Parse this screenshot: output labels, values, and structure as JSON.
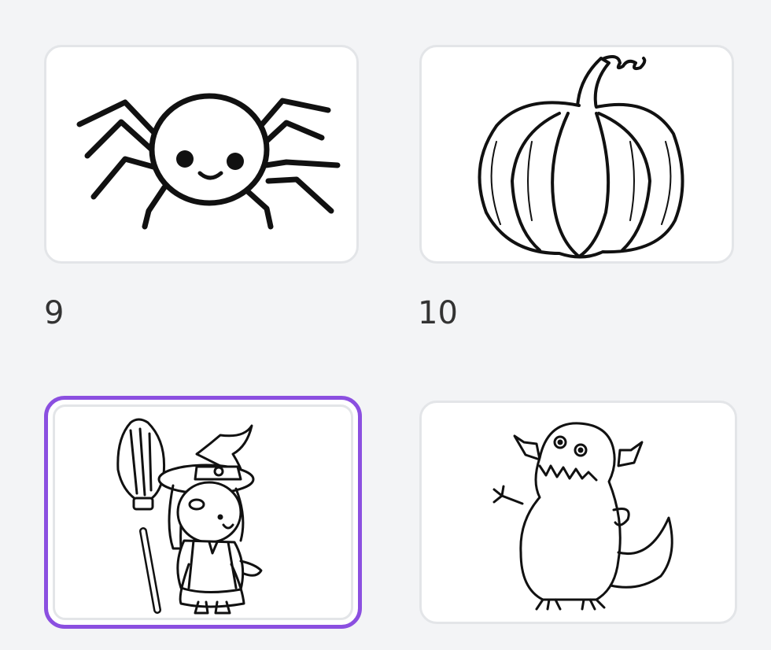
{
  "gallery": {
    "items": [
      {
        "icon": "spider-icon",
        "label": "9",
        "selected": false
      },
      {
        "icon": "pumpkin-icon",
        "label": "10",
        "selected": false
      },
      {
        "icon": "witch-icon",
        "label": "",
        "selected": true
      },
      {
        "icon": "monster-icon",
        "label": "",
        "selected": false
      }
    ],
    "accent_color": "#8b4fe0"
  }
}
